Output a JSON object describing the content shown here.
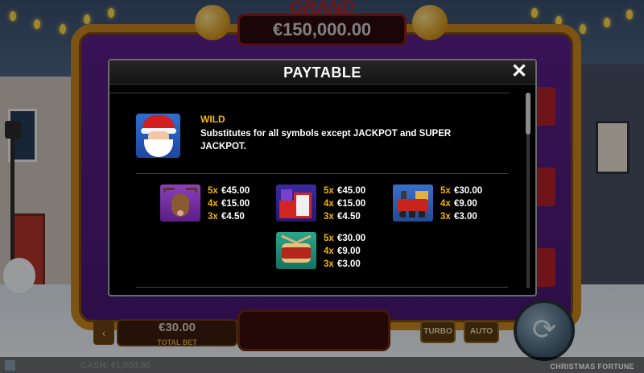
{
  "jackpot": {
    "grand_label": "GRAND",
    "grand_amount": "€150,000.00"
  },
  "bottom_bar": {
    "bet_amount": "€30.00",
    "bet_label": "TOTAL BET",
    "turbo_label": "TURBO",
    "auto_label": "AUTO"
  },
  "footer": {
    "cash": "CASH: €1,000.00",
    "game_title": "CHRISTMAS FORTUNE"
  },
  "paytable": {
    "title": "PAYTABLE",
    "close_glyph": "✕",
    "wild": {
      "title": "WILD",
      "description": "Substitutes for all symbols except JACKPOT and SUPER JACKPOT.",
      "icon": "santa-icon"
    },
    "symbols": [
      {
        "icon": "reindeer-icon",
        "pays": [
          {
            "mult": "5x",
            "amount": "€45.00"
          },
          {
            "mult": "4x",
            "amount": "€15.00"
          },
          {
            "mult": "3x",
            "amount": "€4.50"
          }
        ]
      },
      {
        "icon": "gifts-icon",
        "pays": [
          {
            "mult": "5x",
            "amount": "€45.00"
          },
          {
            "mult": "4x",
            "amount": "€15.00"
          },
          {
            "mult": "3x",
            "amount": "€4.50"
          }
        ]
      },
      {
        "icon": "train-icon",
        "pays": [
          {
            "mult": "5x",
            "amount": "€30.00"
          },
          {
            "mult": "4x",
            "amount": "€9.00"
          },
          {
            "mult": "3x",
            "amount": "€3.00"
          }
        ]
      },
      {
        "icon": "drum-icon",
        "pays": [
          {
            "mult": "5x",
            "amount": "€30.00"
          },
          {
            "mult": "4x",
            "amount": "€9.00"
          },
          {
            "mult": "3x",
            "amount": "€3.00"
          }
        ]
      }
    ]
  },
  "colors": {
    "accent_gold": "#f5b400",
    "modal_bg": "#000000",
    "frame_gold": "#c9861f"
  }
}
